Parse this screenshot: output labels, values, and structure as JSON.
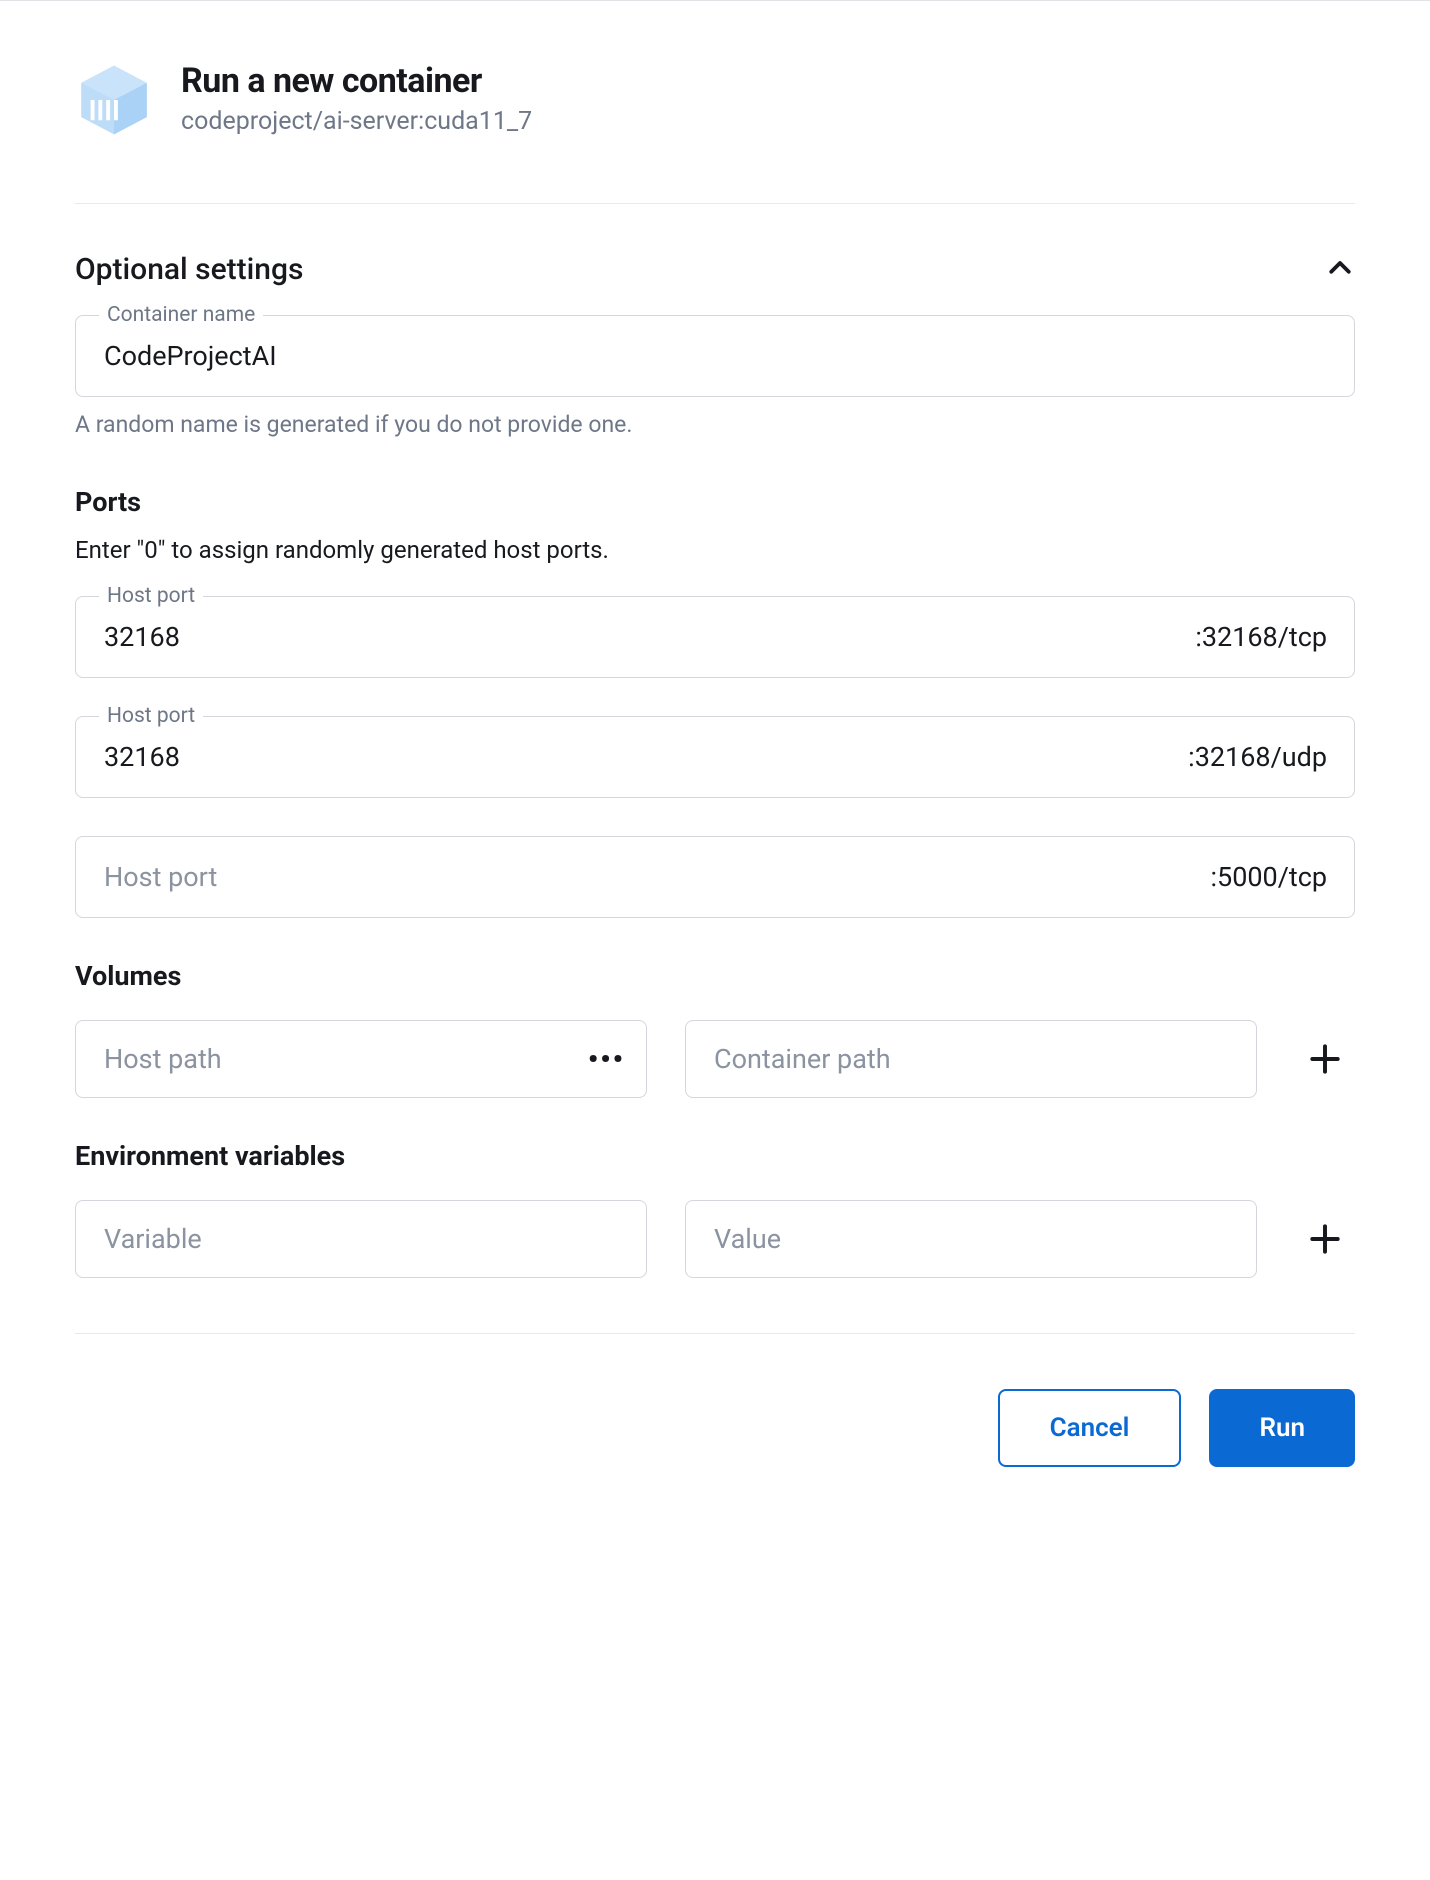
{
  "header": {
    "title": "Run a new container",
    "subtitle": "codeproject/ai-server:cuda11_7"
  },
  "optional": {
    "toggle_label": "Optional settings",
    "container_name": {
      "label": "Container name",
      "value": "CodeProjectAI",
      "helper": "A random name is generated if you do not provide one."
    }
  },
  "ports": {
    "title": "Ports",
    "description": "Enter \"0\" to assign randomly generated host ports.",
    "host_port_label": "Host port",
    "host_port_placeholder": "Host port",
    "rows": [
      {
        "value": "32168",
        "suffix": ":32168/tcp"
      },
      {
        "value": "32168",
        "suffix": ":32168/udp"
      },
      {
        "value": "",
        "suffix": ":5000/tcp"
      }
    ]
  },
  "volumes": {
    "title": "Volumes",
    "host_path_placeholder": "Host path",
    "container_path_placeholder": "Container path"
  },
  "env": {
    "title": "Environment variables",
    "variable_placeholder": "Variable",
    "value_placeholder": "Value"
  },
  "footer": {
    "cancel": "Cancel",
    "run": "Run"
  }
}
